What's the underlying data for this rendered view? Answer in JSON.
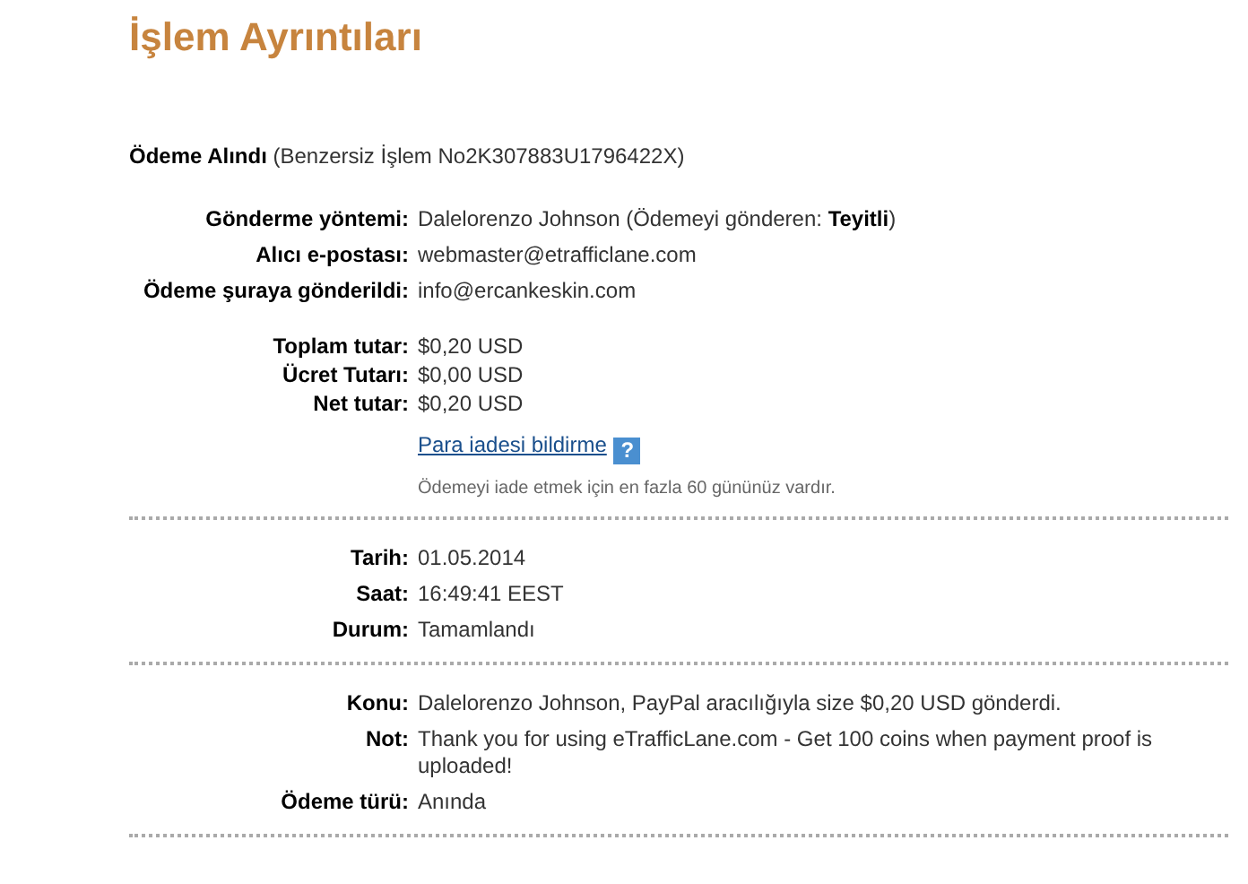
{
  "title": "İşlem Ayrıntıları",
  "status_line": "**Ödeme Alındı** (Benzersiz İşlem No2K307883U1796422X)",
  "sections": [
    {
      "blocks": [
        {
          "rows": [
            {
              "label": "Gönderme yöntemi:",
              "value": "Dalelorenzo Johnson (Ödemeyi gönderen: **Teyitli**)"
            },
            {
              "label": "Alıcı e-postası:",
              "value": "webmaster@etrafficlane.com"
            },
            {
              "label": "Ödeme şuraya gönderildi:",
              "value": "info@ercankeskin.com"
            }
          ]
        },
        {
          "rows": [
            {
              "label": "Toplam tutar:",
              "value": "$0,20 USD"
            },
            {
              "label": "Ücret Tutarı:",
              "value": "$0,00 USD"
            },
            {
              "label": "Net tutar:",
              "value": "$0,20 USD"
            }
          ]
        }
      ],
      "refund": {
        "link": "Para iadesi bildirme",
        "help": "?",
        "note": "Ödemeyi iade etmek için en fazla 60 gününüz vardır."
      }
    },
    {
      "blocks": [
        {
          "rows": [
            {
              "label": "Tarih:",
              "value": "01.05.2014"
            },
            {
              "label": "Saat:",
              "value": "16:49:41 EEST"
            },
            {
              "label": "Durum:",
              "value": "Tamamlandı"
            }
          ]
        }
      ]
    },
    {
      "blocks": [
        {
          "rows": [
            {
              "label": "Konu:",
              "value": "Dalelorenzo Johnson, PayPal aracılığıyla size $0,20 USD gönderdi."
            },
            {
              "label": "Not:",
              "value": "Thank you for using eTrafficLane.com - Get 100 coins when payment proof is uploaded!"
            },
            {
              "label": "Ödeme türü:",
              "value": "Anında"
            }
          ]
        }
      ]
    }
  ]
}
